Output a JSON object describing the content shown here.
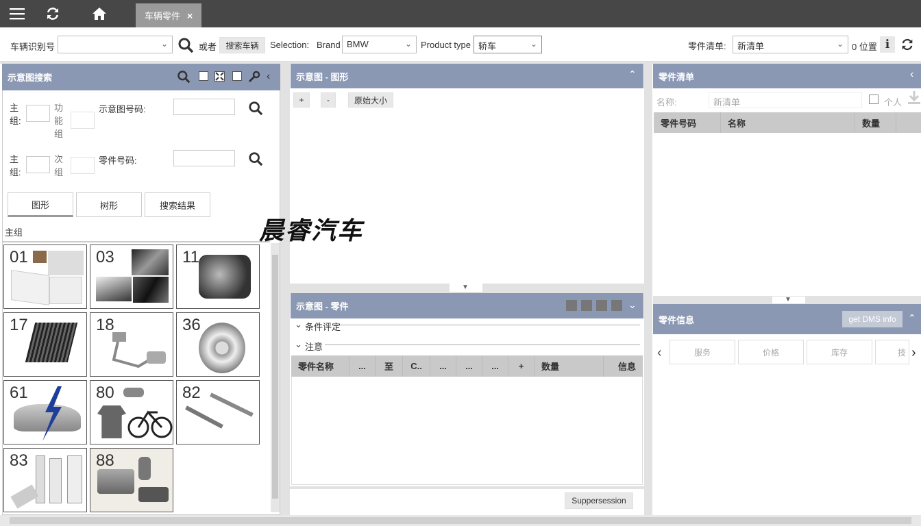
{
  "topbar": {
    "tab_label": "车辆零件",
    "tab_close": "×"
  },
  "toolbar": {
    "vin_label": "车辆识别号",
    "vin_value": "",
    "or_label": "或者",
    "search_vehicle_btn": "搜索车辆",
    "selection_label": "Selection:",
    "brand_label": "Brand",
    "brand_value": "BMW",
    "product_type_label": "Product type",
    "product_type_value": "轿车",
    "parts_list_label": "零件清单:",
    "parts_list_value": "新清单",
    "position_count": "0 位置"
  },
  "diagram_search": {
    "title": "示意图搜索",
    "main_group_label": "主组:",
    "function_group_label": "功能组",
    "sub_group_label": "次组",
    "diagram_number_label": "示意图号码:",
    "part_number_label": "零件号码:",
    "view_tabs": [
      "图形",
      "树形",
      "搜索结果"
    ],
    "group_heading": "主组",
    "tiles": [
      "01",
      "03",
      "11",
      "17",
      "18",
      "36",
      "61",
      "80",
      "82",
      "83",
      "88"
    ]
  },
  "diagram_view": {
    "title": "示意图 - 图形",
    "zoom_in": "+",
    "zoom_out": "-",
    "original_size": "原始大小"
  },
  "diagram_parts": {
    "title": "示意图 - 零件",
    "condition_section": "条件评定",
    "notes_section": "注意",
    "columns": [
      "零件名称",
      "...",
      "至",
      "C..",
      "...",
      "...",
      "...",
      "+",
      "数量",
      "信息"
    ],
    "suppersession_btn": "Suppersession"
  },
  "parts_list": {
    "title": "零件清单",
    "name_label": "名称:",
    "name_placeholder": "新清单",
    "personal_label": "个人",
    "columns": [
      "零件号码",
      "名称",
      "数量"
    ]
  },
  "part_info": {
    "title": "零件信息",
    "dms_btn": "get DMS info",
    "tabs": [
      "服务",
      "价格",
      "库存",
      "技"
    ]
  },
  "watermark": "晨睿汽车",
  "colors": {
    "panel_header": "#8b98b4",
    "topbar": "#474747",
    "tab": "#9a9a9a"
  }
}
